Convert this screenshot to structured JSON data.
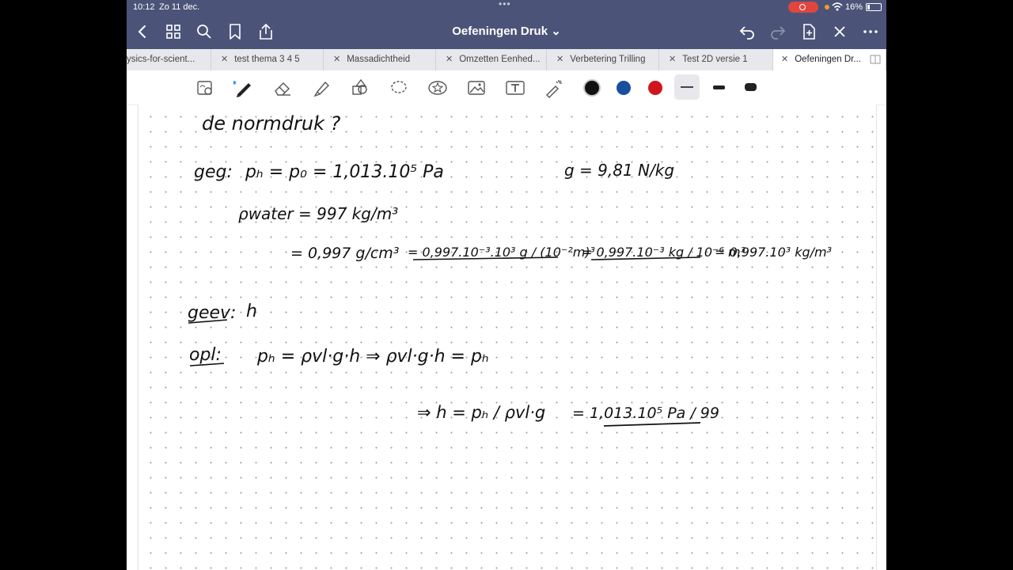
{
  "status_bar": {
    "time": "10:12",
    "date": "Zo 11 dec.",
    "battery": "16%"
  },
  "header": {
    "title": "Oefeningen Druk ⌄"
  },
  "tabs": [
    {
      "label": "ysics-for-scient..."
    },
    {
      "label": "test thema 3 4 5"
    },
    {
      "label": "Massadichtheid"
    },
    {
      "label": "Omzetten Eenhed..."
    },
    {
      "label": "Verbetering Trilling"
    },
    {
      "label": "Test 2D versie 1"
    },
    {
      "label": "Oefeningen Dr..."
    }
  ],
  "colors": {
    "header_bg": "#4b5478",
    "pen_black": "#111111",
    "pen_blue": "#1a4fa0",
    "pen_red": "#d0161c"
  },
  "icons": {
    "back": "chevron-left-icon",
    "grid": "grid-icon",
    "search": "search-icon",
    "bookmark": "bookmark-icon",
    "share": "share-icon",
    "undo": "undo-icon",
    "redo": "redo-icon",
    "add_page": "add-page-icon",
    "close": "close-icon",
    "more": "more-icon"
  },
  "notes": {
    "line_top": "de normdruk ?",
    "gegeven_label": "geg:",
    "p_equation": "pₕ = p₀ = 1,013.10⁵ Pa",
    "g_value": "g = 9,81 N/kg",
    "rho_water": "ρwater = 997 kg/m³",
    "conversion_1": "= 0,997 g/cm³",
    "conversion_2": "= 0,997.10⁻³.10³ g / (10⁻²m)³",
    "conversion_3": "= 0,997.10⁻³ kg / 10⁻⁶ m³",
    "conversion_4": "= 0,997.10³ kg/m³",
    "gevraagd_label": "geev:",
    "gevraagd_value": "h",
    "oplossing_label": "opl:",
    "formula_1": "pₕ = ρvl·g·h  ⇒  ρvl·g·h = pₕ",
    "formula_2": "⇒  h = pₕ / ρvl·g",
    "formula_3": "= 1,013.10⁵ Pa / 99"
  }
}
